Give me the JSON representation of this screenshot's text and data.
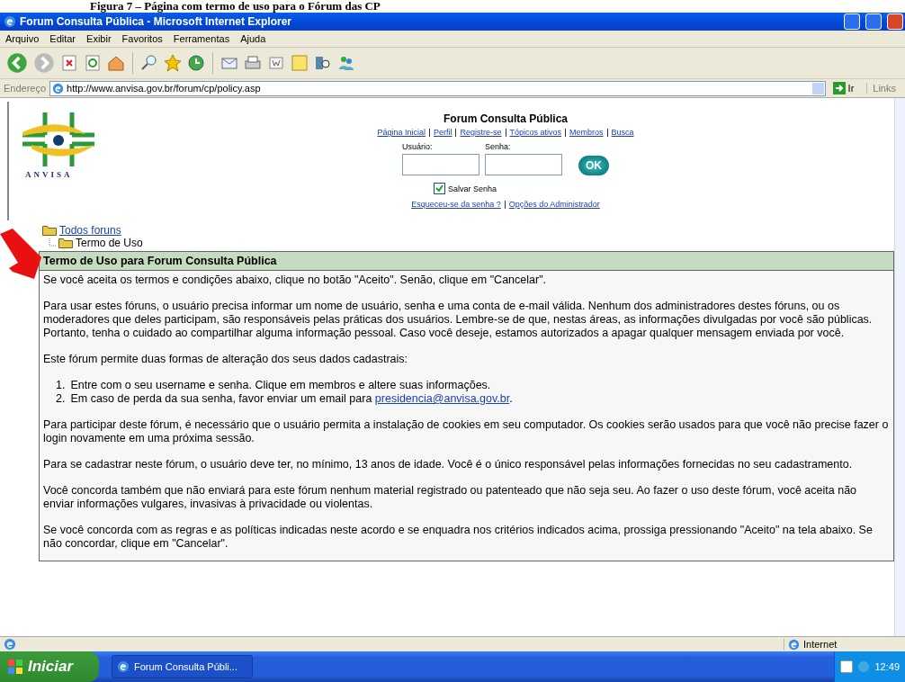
{
  "caption": "Figura 7 – Página com termo de uso para o Fórum das CP",
  "window": {
    "title": "Forum Consulta Pública - Microsoft Internet Explorer"
  },
  "menu": [
    "Arquivo",
    "Editar",
    "Exibir",
    "Favoritos",
    "Ferramentas",
    "Ajuda"
  ],
  "address_bar": {
    "label": "Endereço",
    "value": "http://www.anvisa.gov.br/forum/cp/policy.asp",
    "go": "Ir",
    "links": "Links"
  },
  "logo": {
    "text": "ANVISA"
  },
  "header": {
    "title": "Forum Consulta Pública",
    "nav": [
      "Página Inicial",
      "Perfil",
      "Registre-se",
      "Tópicos ativos",
      "Membros",
      "Busca"
    ],
    "user_label": "Usuário:",
    "password_label": "Senha:",
    "ok": "OK",
    "save_password": {
      "label": "Salvar Senha",
      "checked": true
    },
    "links": [
      "Esqueceu-se da senha ?",
      "Opções do Administrador"
    ]
  },
  "breadcrumb": {
    "root": "Todos foruns",
    "current": "Termo de Uso"
  },
  "terms": {
    "title": "Termo de Uso para Forum Consulta Pública",
    "blocks": [
      {
        "kind": "paragraph",
        "text": "Se você aceita os termos e condições abaixo, clique no botão \"Aceito\". Senão, clique em \"Cancelar\"."
      },
      {
        "kind": "paragraph",
        "text": "Para usar estes fóruns, o usuário precisa informar um nome de usuário, senha e uma conta de e-mail válida. Nenhum dos administradores destes fóruns, ou os moderadores que deles participam, são responsáveis pelas práticas dos usuários. Lembre-se de que, nestas áreas, as informações divulgadas por você são públicas. Portanto, tenha o cuidado ao compartilhar alguma informação pessoal. Caso você deseje, estamos autorizados a apagar qualquer mensagem enviada por você."
      },
      {
        "kind": "paragraph",
        "text": "Este fórum permite duas formas de alteração dos seus dados cadastrais:"
      },
      {
        "kind": "list",
        "items": [
          {
            "number": "1.",
            "text": "Entre com o seu username e senha. Clique em membros e altere suas informações."
          },
          {
            "number": "2.",
            "text": "Em caso de perda da sua senha, favor enviar um email para",
            "link": "presidencia@anvisa.gov.br",
            "after": "."
          }
        ]
      },
      {
        "kind": "paragraph",
        "text": "Para participar deste fórum, é necessário que o usuário permita a instalação de cookies em seu computador. Os cookies serão usados para que você não precise fazer o login novamente em uma próxima sessão."
      },
      {
        "kind": "paragraph",
        "text": "Para se cadastrar neste fórum, o usuário deve ter, no mínimo, 13 anos de idade. Você é o único responsável pelas informações fornecidas no seu cadastramento."
      },
      {
        "kind": "paragraph",
        "text": "Você concorda também que não enviará para este fórum nenhum material registrado ou patenteado que não seja seu. Ao fazer o uso deste fórum, você aceita não enviar informações vulgares, invasivas à privacidade ou violentas."
      },
      {
        "kind": "paragraph",
        "text": "Se você concorda com as regras e as políticas indicadas neste acordo e se enquadra nos critérios indicados acima, prossiga pressionando \"Aceito\" na tela abaixo. Se não concordar, clique em \"Cancelar\"."
      }
    ]
  },
  "status_bar": {
    "zone": "Internet"
  },
  "taskbar": {
    "start": "Iniciar",
    "task": "Forum Consulta Públi...",
    "clock": "12:49"
  }
}
